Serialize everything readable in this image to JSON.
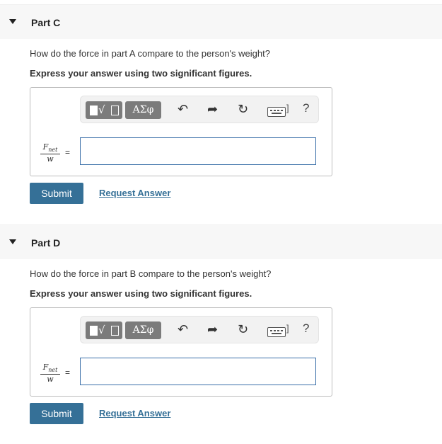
{
  "parts": [
    {
      "title": "Part C",
      "question": "How do the force in part A compare to the person's weight?",
      "instruction": "Express your answer using two significant figures.",
      "toolbar": {
        "greek_label": "ΑΣφ",
        "help_label": "?"
      },
      "fraction": {
        "numerator": "F",
        "numerator_sub": "net",
        "denominator": "w",
        "equals": "="
      },
      "answer_value": "",
      "submit_label": "Submit",
      "request_label": "Request Answer"
    },
    {
      "title": "Part D",
      "question": "How do the force in part B compare to the person's weight?",
      "instruction": "Express your answer using two significant figures.",
      "toolbar": {
        "greek_label": "ΑΣφ",
        "help_label": "?"
      },
      "fraction": {
        "numerator": "F",
        "numerator_sub": "net",
        "denominator": "w",
        "equals": "="
      },
      "answer_value": "",
      "submit_label": "Submit",
      "request_label": "Request Answer"
    }
  ]
}
